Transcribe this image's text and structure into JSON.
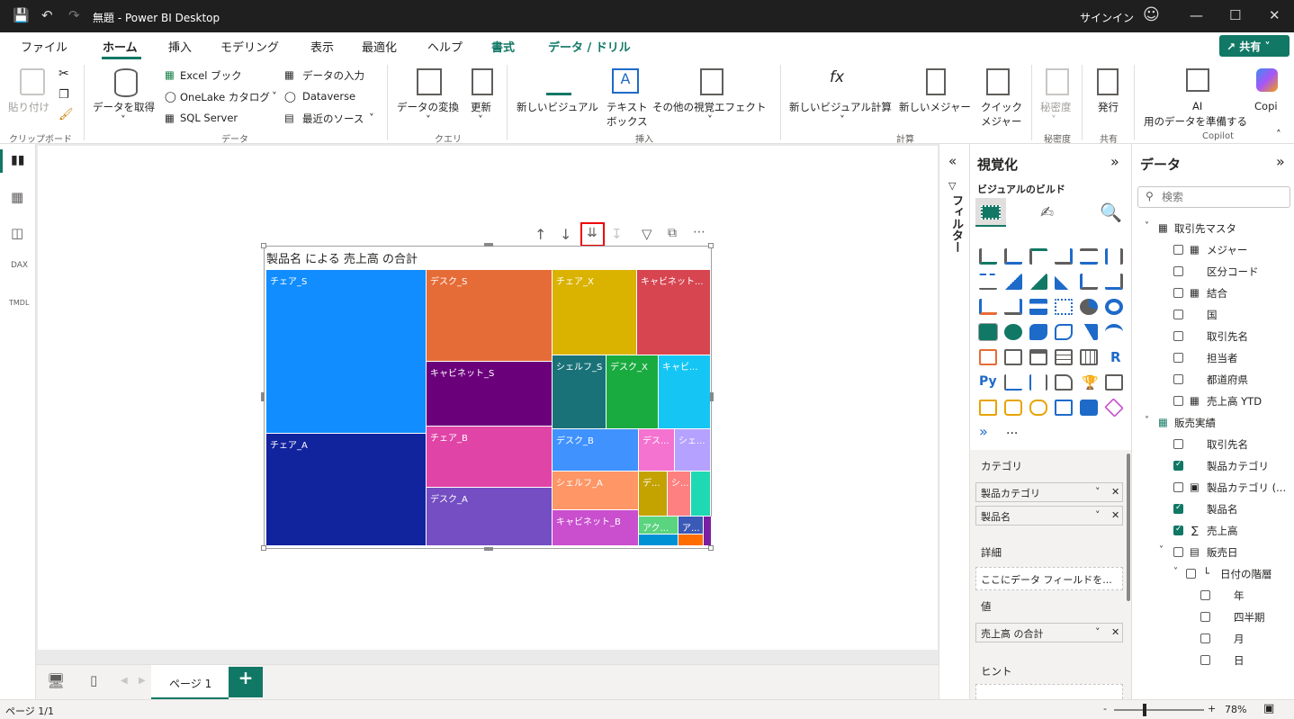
{
  "titlebar": {
    "title": "無題 - Power BI Desktop",
    "signin": "サインイン"
  },
  "tabs": [
    {
      "label": "ファイル"
    },
    {
      "label": "ホーム"
    },
    {
      "label": "挿入"
    },
    {
      "label": "モデリング"
    },
    {
      "label": "表示"
    },
    {
      "label": "最適化"
    },
    {
      "label": "ヘルプ"
    },
    {
      "label": "書式"
    },
    {
      "label": "データ / ドリル"
    }
  ],
  "share": "共有",
  "ribbon": {
    "paste": "貼り付け",
    "clipboard_group": "クリップボード",
    "get_data": "データを取得",
    "excel": "Excel ブック",
    "onelake": "OneLake カタログ",
    "sql": "SQL Server",
    "enter_data": "データの入力",
    "dataverse": "Dataverse",
    "recent": "最近のソース",
    "data_group": "データ",
    "transform": "データの変換",
    "refresh": "更新",
    "query_group": "クエリ",
    "new_visual": "新しいビジュアル",
    "textbox_1": "テキスト",
    "textbox_2": "ボックス",
    "more_visuals": "その他の視覚エフェクト",
    "insert_group": "挿入",
    "new_visual_calc": "新しいビジュアル計算",
    "new_measure": "新しいメジャー",
    "quick_measure_1": "クイック",
    "quick_measure_2": "メジャー",
    "calc_group": "計算",
    "sensitivity": "秘密度",
    "sensitivity_group": "秘密度",
    "publish": "発行",
    "share_group": "共有",
    "ai_1": "AI",
    "ai_2": "用のデータを準備する",
    "copilot": "Copi",
    "copilot_group": "Copilot"
  },
  "visual": {
    "title": "製品名 による 売上高 の合計",
    "cells": [
      "チェア_S",
      "チェア_A",
      "デスク_S",
      "キャビネット_S",
      "チェア_B",
      "デスク_A",
      "チェア_X",
      "キャビネット...",
      "シェルフ_S",
      "デスク_X",
      "キャビ...",
      "デスク_B",
      "デス...",
      "シェ...",
      "シェルフ_A",
      "デ...",
      "シ...",
      "キャビネット_B",
      "アク...",
      "ア..."
    ]
  },
  "filters_label": "フィルター",
  "viz": {
    "title": "視覚化",
    "build": "ビジュアルのビルド",
    "wells": {
      "category": "カテゴリ",
      "category_items": [
        "製品カテゴリ",
        "製品名"
      ],
      "details": "詳細",
      "details_placeholder": "ここにデータ フィールドを...",
      "values": "値",
      "values_item": "売上高 の合計",
      "tooltip": "ヒント"
    },
    "more": "..."
  },
  "data": {
    "title": "データ",
    "search_placeholder": "検索",
    "tables": [
      {
        "name": "取引先マスタ",
        "fields": [
          "メジャー",
          "区分コード",
          "結合",
          "国",
          "取引先名",
          "担当者",
          "都道府県",
          "売上高 YTD"
        ]
      },
      {
        "name": "販売実績",
        "fields": [
          "取引先名",
          "製品カテゴリ",
          "製品カテゴリ (...",
          "製品名",
          "売上高",
          "販売日",
          "日付の階層",
          "年",
          "四半期",
          "月",
          "日"
        ]
      }
    ]
  },
  "bottom": {
    "page_tab": "ページ 1",
    "add": "+"
  },
  "status": {
    "page": "ページ 1/1",
    "zoom": "78%",
    "minus": "-",
    "plus": "+"
  },
  "colors": {
    "accent": "#117865",
    "title_bg": "#1f1f1f"
  }
}
